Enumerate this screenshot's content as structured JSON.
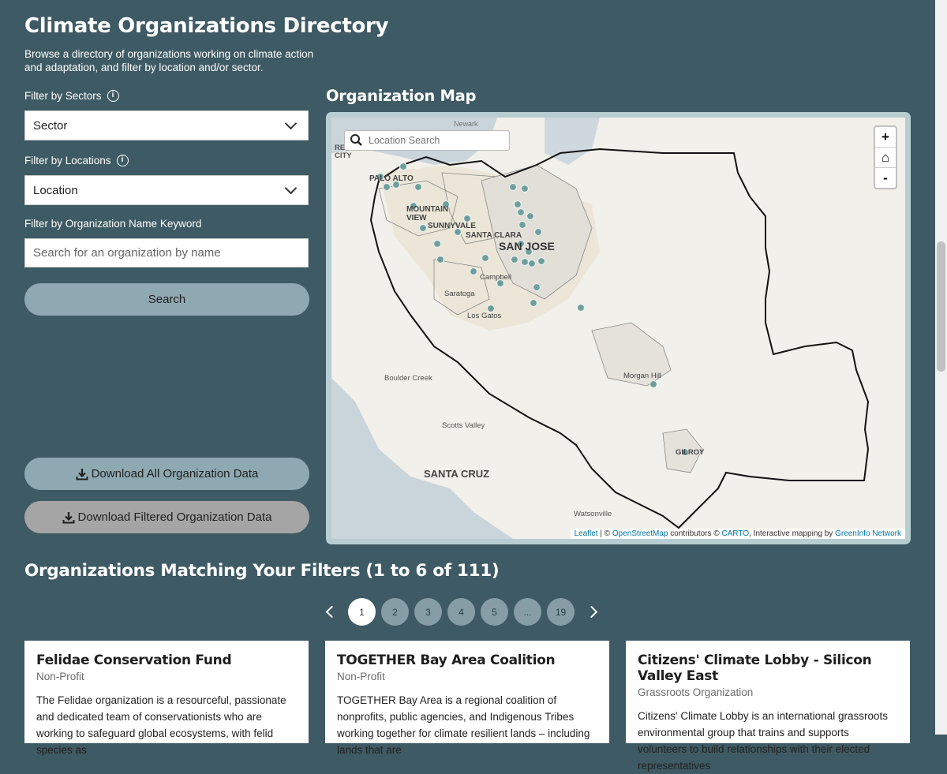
{
  "header": {
    "title": "Climate Organizations Directory",
    "intro": "Browse a directory of organizations working on climate action and adaptation, and filter by location and/or sector."
  },
  "filters": {
    "sectors_label": "Filter by Sectors",
    "sectors_value": "Sector",
    "locations_label": "Filter by Locations",
    "locations_value": "Location",
    "keyword_label": "Filter by Organization Name Keyword",
    "keyword_placeholder": "Search for an organization by name",
    "search_button": "Search",
    "info_glyph": "i"
  },
  "downloads": {
    "all_label": "Download All Organization Data",
    "filtered_label": "Download Filtered Organization Data"
  },
  "map": {
    "title": "Organization Map",
    "search_placeholder": "Location Search",
    "zoom_in": "+",
    "home": "⌂",
    "zoom_out": "-",
    "places": {
      "newark": "Newark",
      "redwood_city": "REDWOOD\nCITY",
      "palo_alto": "PALO ALTO",
      "mountain_view": "MOUNTAIN\nVIEW",
      "sunnyvale": "SUNNYVALE",
      "santa_clara": "SANTA CLARA",
      "san_jose": "SAN JOSE",
      "campbell": "Campbell",
      "saratoga": "Saratoga",
      "los_gatos": "Los Gatos",
      "morgan_hill": "Morgan Hill",
      "boulder_creek": "Boulder Creek",
      "scotts_valley": "Scotts Valley",
      "santa_cruz": "SANTA CRUZ",
      "gilroy": "GILROY",
      "watsonville": "Watsonville"
    },
    "attribution": {
      "leaflet": "Leaflet",
      "sep1": " | © ",
      "osm": "OpenStreetMap",
      "mid": " contributors © ",
      "carto": "CARTO",
      "tail": ", Interactive mapping by ",
      "greeninfo": "GreenInfo Network"
    }
  },
  "results": {
    "heading": "Organizations Matching Your Filters (1 to 6 of 111)",
    "pages": [
      "1",
      "2",
      "3",
      "4",
      "5",
      "...",
      "19"
    ],
    "current_page": "1"
  },
  "cards": [
    {
      "name": "Felidae Conservation Fund",
      "type": "Non-Profit",
      "description": "The Felidae organization is a resourceful, passionate and dedicated team of conservationists who are working to safeguard global ecosystems, with felid species as"
    },
    {
      "name": "TOGETHER Bay Area Coalition",
      "type": "Non-Profit",
      "description": "TOGETHER Bay Area is a regional coalition of nonprofits, public agencies, and Indigenous Tribes working together for climate resilient lands – including lands that are"
    },
    {
      "name": "Citizens' Climate Lobby - Silicon Valley East",
      "type": "Grassroots Organization",
      "description": "Citizens' Climate Lobby is an international grassroots environmental group that trains and supports volunteers to build relationships with their elected representatives"
    }
  ],
  "colors": {
    "page_bg": "#3e5a64",
    "button_primary": "#8fa9b3",
    "button_disabled": "#a5a5a5",
    "marker": "#6d9e9c"
  }
}
